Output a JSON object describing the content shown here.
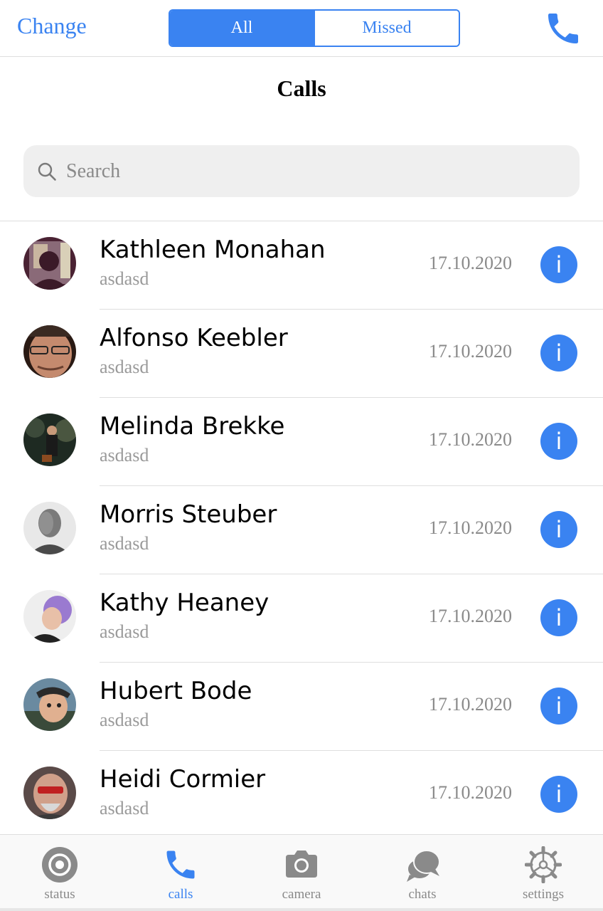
{
  "header": {
    "change_label": "Change",
    "segments": [
      {
        "label": "All",
        "active": true
      },
      {
        "label": "Missed",
        "active": false
      }
    ],
    "call_icon": "phone-icon"
  },
  "page_title": "Calls",
  "search": {
    "placeholder": "Search",
    "value": "",
    "icon": "search-icon"
  },
  "calls": [
    {
      "name": "Kathleen Monahan",
      "subtitle": "asdasd",
      "date": "17.10.2020",
      "info": "i"
    },
    {
      "name": "Alfonso Keebler",
      "subtitle": "asdasd",
      "date": "17.10.2020",
      "info": "i"
    },
    {
      "name": "Melinda Brekke",
      "subtitle": "asdasd",
      "date": "17.10.2020",
      "info": "i"
    },
    {
      "name": "Morris Steuber",
      "subtitle": "asdasd",
      "date": "17.10.2020",
      "info": "i"
    },
    {
      "name": "Kathy Heaney",
      "subtitle": "asdasd",
      "date": "17.10.2020",
      "info": "i"
    },
    {
      "name": "Hubert Bode",
      "subtitle": "asdasd",
      "date": "17.10.2020",
      "info": "i"
    },
    {
      "name": "Heidi Cormier",
      "subtitle": "asdasd",
      "date": "17.10.2020",
      "info": "i"
    }
  ],
  "tabs": [
    {
      "label": "status",
      "icon": "status-icon",
      "active": false
    },
    {
      "label": "calls",
      "icon": "phone-icon",
      "active": true
    },
    {
      "label": "camera",
      "icon": "camera-icon",
      "active": false
    },
    {
      "label": "chats",
      "icon": "chat-bubbles-icon",
      "active": false
    },
    {
      "label": "settings",
      "icon": "gear-icon",
      "active": false
    }
  ],
  "colors": {
    "accent": "#3a83f1",
    "muted": "#8a8a8a",
    "divider": "#dedede",
    "search_bg": "#efefef"
  }
}
